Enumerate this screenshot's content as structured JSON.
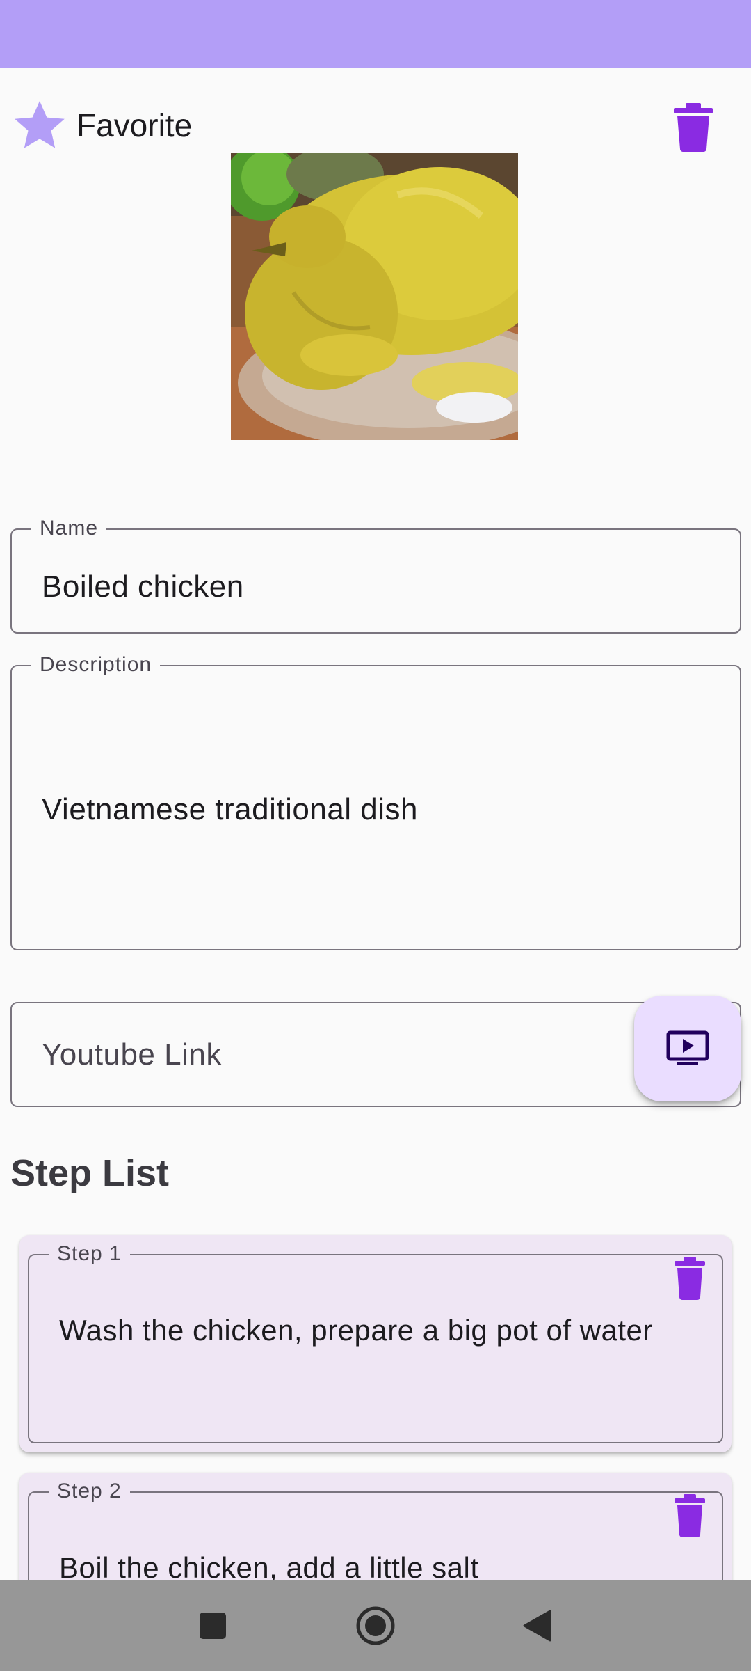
{
  "header": {
    "favorite_label": "Favorite"
  },
  "recipe": {
    "image_alt": "Boiled chicken photo",
    "name_label": "Name",
    "name_value": "Boiled chicken",
    "description_label": "Description",
    "description_value": "Vietnamese traditional dish",
    "youtube_placeholder": "Youtube Link",
    "youtube_value": ""
  },
  "steps": {
    "title": "Step List",
    "items": [
      {
        "label": "Step 1",
        "text": "Wash the chicken, prepare a big pot of water"
      },
      {
        "label": "Step 2",
        "text": "Boil the chicken, add a little salt"
      }
    ]
  },
  "icons": {
    "favorite": "star-icon",
    "delete": "trash-icon",
    "youtube": "tv-play-icon",
    "nav_recents": "square-icon",
    "nav_home": "circle-icon",
    "nav_back": "triangle-back-icon"
  },
  "colors": {
    "status_bar": "#b39ef7",
    "accent": "#8a2be2",
    "star": "#b39ef7",
    "fab": "#eaddff",
    "card": "#efe6f4",
    "nav_bar": "#979797"
  }
}
